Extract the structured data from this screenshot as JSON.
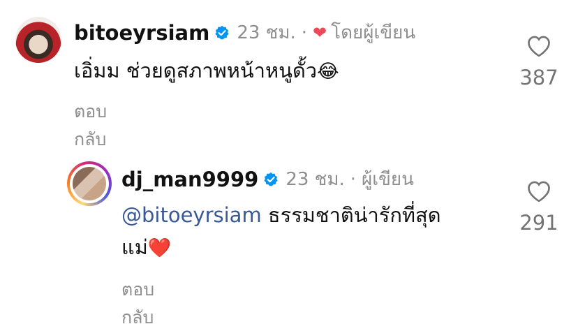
{
  "comment1": {
    "username": "bitoeyrsiam",
    "time": "23 ชม.",
    "author_like": "โดยผู้เขียน",
    "text": "เอิ่มม ช่วยดูสภาพหน้าหนูดั้ว",
    "emoji": "😂",
    "reply": "ตอบกลับ",
    "likes": "387"
  },
  "comment2": {
    "username": "dj_man9999",
    "time": "23 ชม.",
    "author_label": "ผู้เขียน",
    "mention": "@bitoeyrsiam",
    "text_line1": " ธรรมชาติน่ารักที่สุด",
    "text_line2": "แม่",
    "emoji": "❤️",
    "reply": "ตอบกลับ",
    "likes": "291"
  },
  "icons": {
    "verified": "verified-badge-icon",
    "like": "heart-outline-icon"
  },
  "colors": {
    "verified": "#0095f6",
    "mention": "#385898",
    "secondary": "#8e8e8e",
    "author_heart": "#ed4956"
  }
}
